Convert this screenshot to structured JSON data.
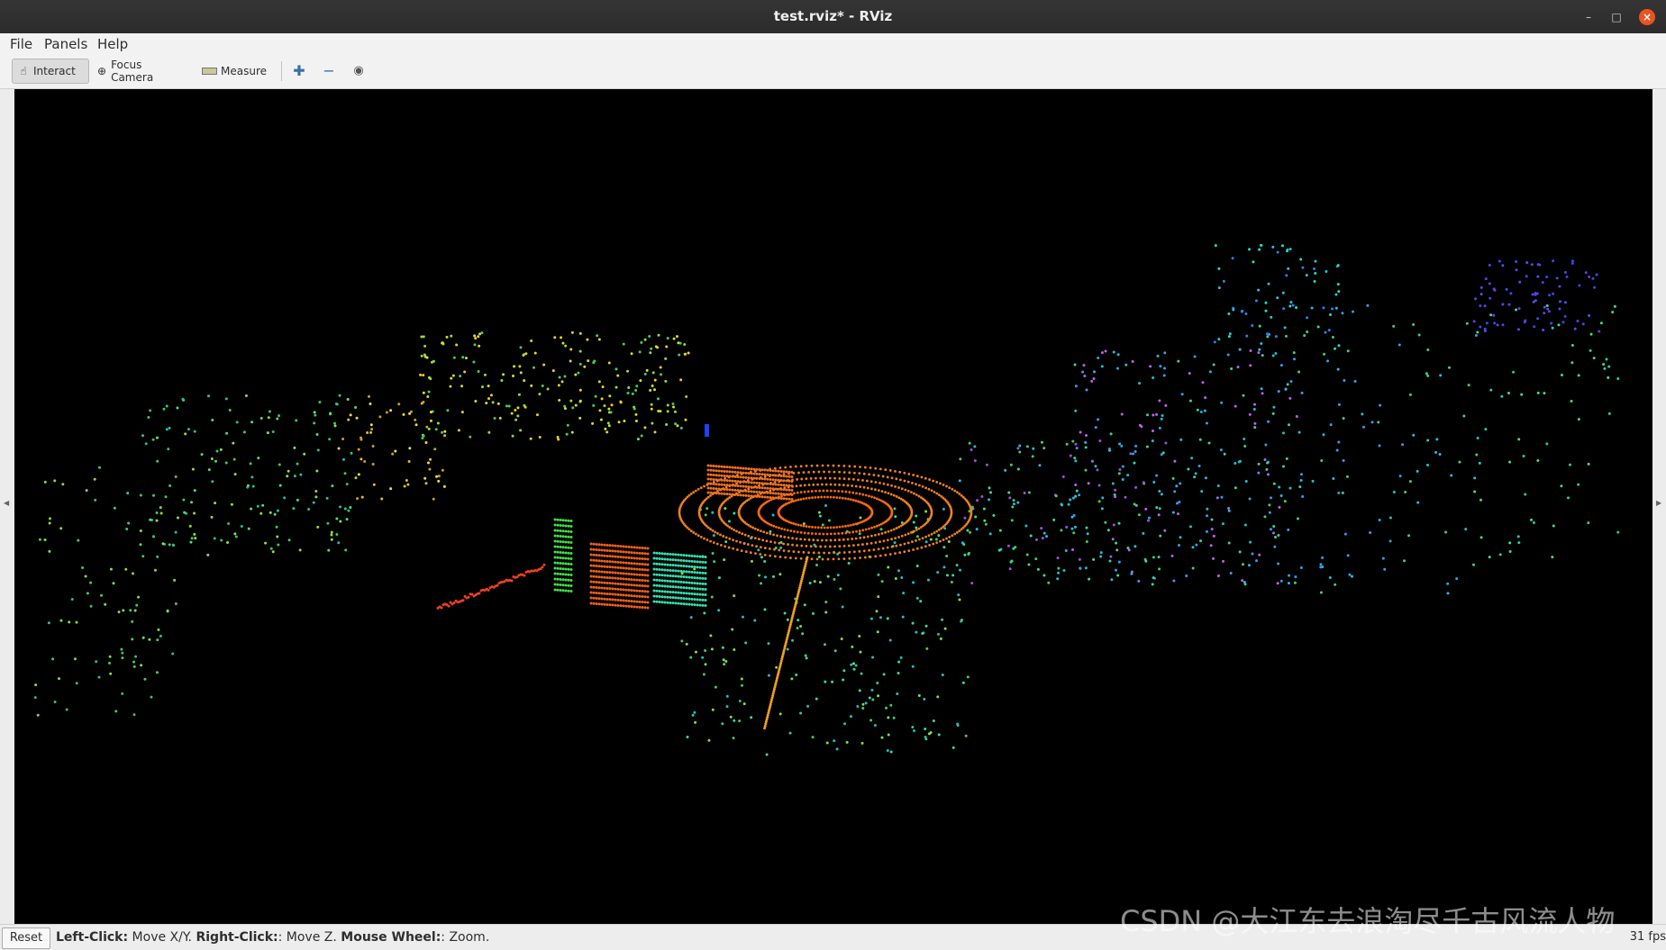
{
  "window": {
    "title": "test.rviz* - RViz"
  },
  "menu": {
    "file": "File",
    "panels": "Panels",
    "help": "Help"
  },
  "toolbar": {
    "interact": "Interact",
    "focus_camera": "Focus Camera",
    "measure": "Measure"
  },
  "status": {
    "reset": "Reset",
    "left_click_key": "Left-Click:",
    "left_click_val": " Move X/Y. ",
    "right_click_key": "Right-Click:",
    "right_click_val": ": Move Z. ",
    "wheel_key": "Mouse Wheel:",
    "wheel_val": ": Zoom.",
    "fps": "31 fps"
  },
  "watermark": "CSDN @大江东去浪淘尽千古风流人物",
  "colors": {
    "accent": "#e95420",
    "viewport_bg": "#000000"
  }
}
